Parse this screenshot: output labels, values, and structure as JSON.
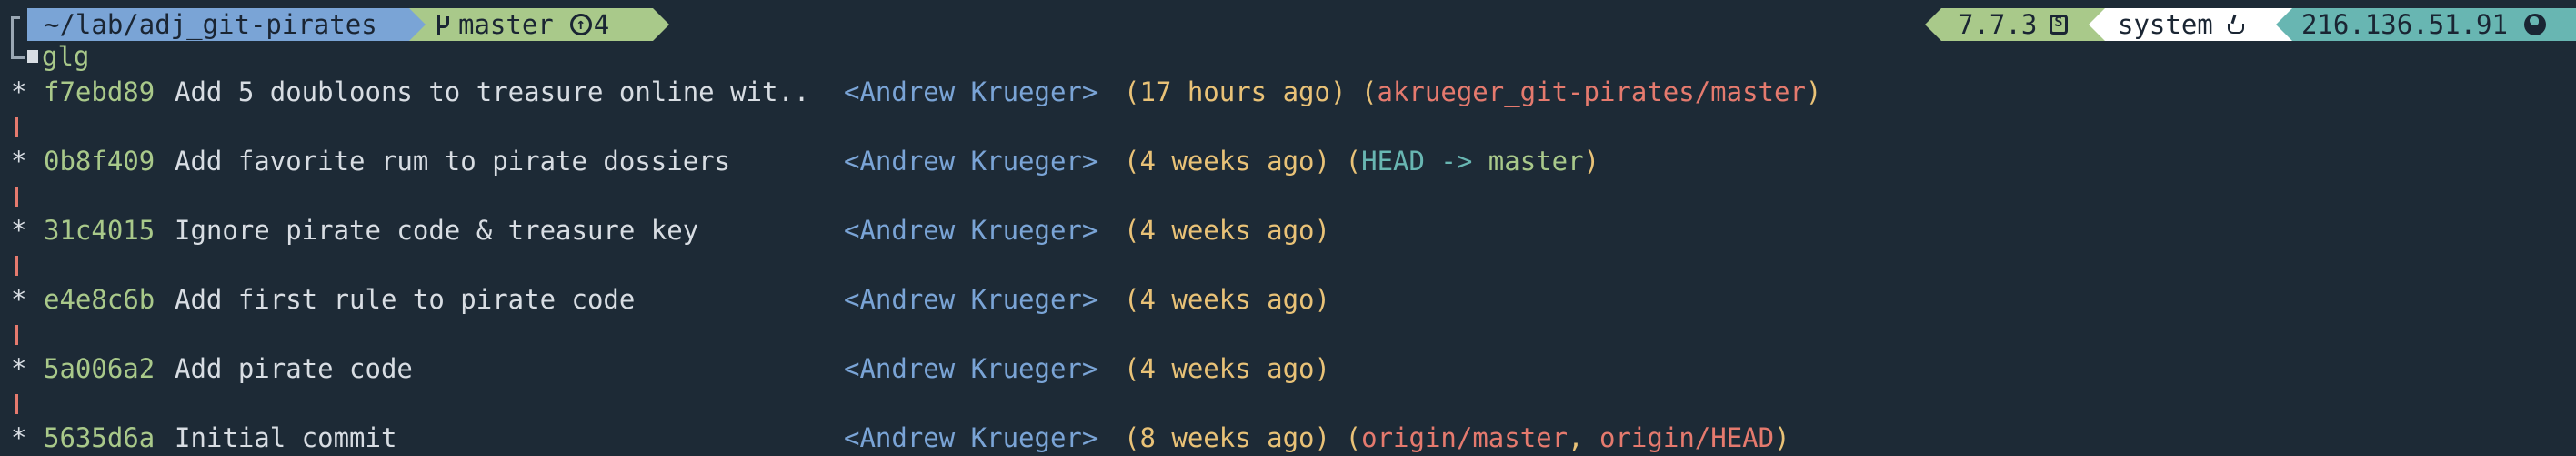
{
  "prompt": {
    "directory": "~/lab/adj_git-pirates",
    "branch": "master",
    "ahead_count": "4",
    "node_version": "7.7.3",
    "java_env": "system",
    "ip_address": "216.136.51.91",
    "colors": {
      "dir_bg": "#7aa4d6",
      "git_bg": "#a9c98a",
      "ip_bg": "#68b6b2",
      "terminal_bg": "#1d2a36"
    },
    "icons": [
      "branch-icon",
      "ahead-arrow-icon",
      "nodejs-icon",
      "java-icon",
      "globe-icon"
    ]
  },
  "command": "glg",
  "log": [
    {
      "hash": "f7ebd89",
      "message": "Add 5 doubloons to treasure online wit..",
      "author": "<Andrew Krueger>",
      "when": "(17 hours ago)",
      "refs": [
        {
          "open": " (",
          "name": "akrueger_git-pirates/master",
          "style": "red",
          "close": ")"
        }
      ]
    },
    {
      "hash": "0b8f409",
      "message": "Add favorite rum to pirate dossiers",
      "author": "<Andrew Krueger>",
      "when": "(4 weeks ago)",
      "refs": [
        {
          "open": " (",
          "name": "HEAD -> ",
          "style": "teal",
          "close": ""
        },
        {
          "open": "",
          "name": "master",
          "style": "green",
          "close": ")"
        }
      ]
    },
    {
      "hash": "31c4015",
      "message": "Ignore pirate code & treasure key",
      "author": "<Andrew Krueger>",
      "when": "(4 weeks ago)",
      "refs": []
    },
    {
      "hash": "e4e8c6b",
      "message": "Add first rule to pirate code",
      "author": "<Andrew Krueger>",
      "when": "(4 weeks ago)",
      "refs": []
    },
    {
      "hash": "5a006a2",
      "message": "Add pirate code",
      "author": "<Andrew Krueger>",
      "when": "(4 weeks ago)",
      "refs": []
    },
    {
      "hash": "5635d6a",
      "message": "Initial commit",
      "author": "<Andrew Krueger>",
      "when": "(8 weeks ago)",
      "refs": [
        {
          "open": " (",
          "name": "origin/master",
          "style": "red",
          "close": ""
        },
        {
          "open": ", ",
          "name": "origin/HEAD",
          "style": "red",
          "close": ")"
        }
      ]
    }
  ]
}
